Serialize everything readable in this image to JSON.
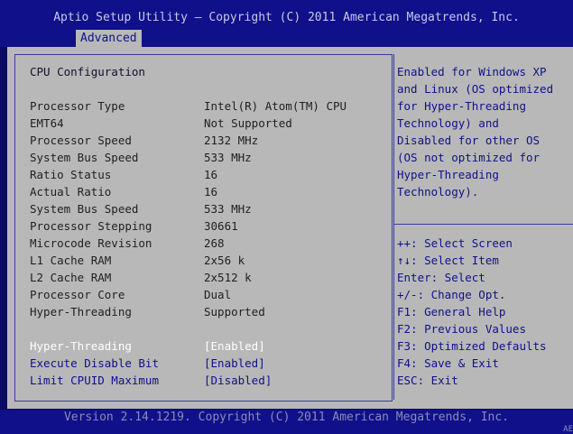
{
  "header": {
    "title": "Aptio Setup Utility – Copyright (C) 2011 American Megatrends, Inc.",
    "active_tab": "Advanced"
  },
  "left": {
    "section_title": "CPU Configuration",
    "info_rows": [
      {
        "label": "Processor Type",
        "value": "Intel(R) Atom(TM) CPU"
      },
      {
        "label": "EMT64",
        "value": "Not Supported"
      },
      {
        "label": "Processor Speed",
        "value": "2132 MHz"
      },
      {
        "label": "System Bus Speed",
        "value": "533 MHz"
      },
      {
        "label": "Ratio Status",
        "value": "16"
      },
      {
        "label": "Actual Ratio",
        "value": "16"
      },
      {
        "label": "System Bus Speed",
        "value": "533 MHz"
      },
      {
        "label": "Processor Stepping",
        "value": "30661"
      },
      {
        "label": "Microcode Revision",
        "value": "268"
      },
      {
        "label": "L1 Cache RAM",
        "value": "2x56 k"
      },
      {
        "label": "L2 Cache RAM",
        "value": "2x512 k"
      },
      {
        "label": "Processor Core",
        "value": "Dual"
      },
      {
        "label": "Hyper-Threading",
        "value": "Supported"
      }
    ],
    "options": [
      {
        "label": "Hyper-Threading",
        "value": "[Enabled]",
        "selected": true
      },
      {
        "label": "Execute Disable Bit",
        "value": "[Enabled]",
        "selected": false
      },
      {
        "label": "Limit CPUID Maximum",
        "value": "[Disabled]",
        "selected": false
      }
    ]
  },
  "help": {
    "lines": [
      "Enabled for Windows XP",
      "and Linux (OS optimized",
      "for Hyper-Threading",
      "Technology) and",
      "Disabled for other OS",
      "(OS not optimized for",
      "Hyper-Threading",
      "Technology)."
    ]
  },
  "keys": {
    "lines": [
      "++: Select Screen",
      "↑↓: Select Item",
      "Enter: Select",
      "+/-: Change Opt.",
      "F1: General Help",
      "F2: Previous Values",
      "F3: Optimized Defaults",
      "F4: Save & Exit",
      "ESC: Exit"
    ]
  },
  "footer": {
    "version": "Version 2.14.1219. Copyright (C) 2011 American Megatrends, Inc.",
    "corner": "AE"
  },
  "colors": {
    "header_bg": "#10108a",
    "panel_bg": "#b8b8b8",
    "selected_text": "#ffffff",
    "option_text": "#10108a",
    "info_text": "#1f1f1f"
  }
}
